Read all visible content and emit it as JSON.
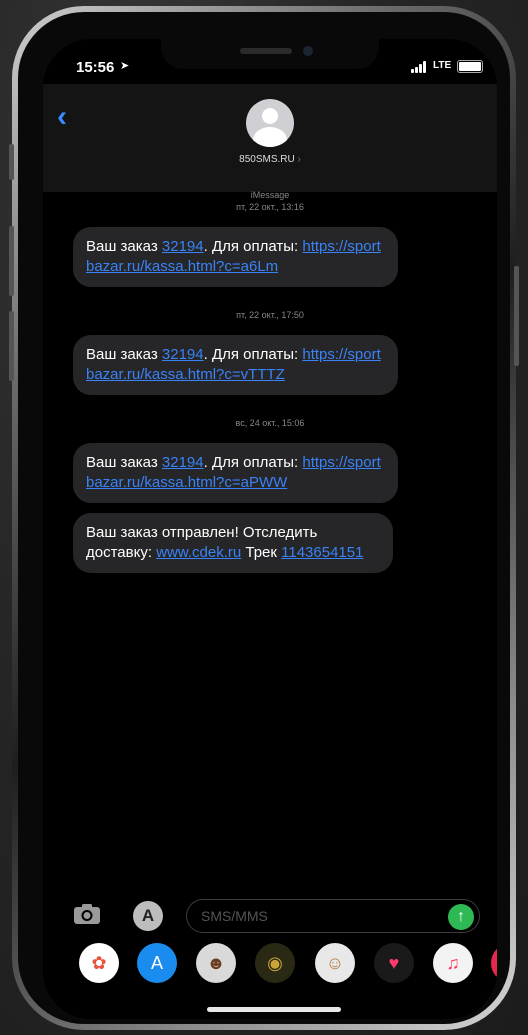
{
  "status_bar": {
    "time": "15:56",
    "network": "LTE"
  },
  "header": {
    "contact_name": "850SMS.RU"
  },
  "messages": [
    {
      "timestamp": "iMessage\nпт, 22 окт., 13:16",
      "text_before": "Ваш заказ ",
      "order": "32194",
      "text_mid": ". Для оплаты: ",
      "link": "https://sportbazar.ru/kassa.html?c=a6Lm"
    },
    {
      "timestamp": "пт, 22 окт., 17:50",
      "text_before": "Ваш заказ ",
      "order": "32194",
      "text_mid": ". Для оплаты: ",
      "link": "https://sportbazar.ru/kassa.html?c=vTTTZ"
    },
    {
      "timestamp": "вс, 24 окт., 15:06",
      "text_before": "Ваш заказ ",
      "order": "32194",
      "text_mid": ". Для оплаты: ",
      "link": "https://sportbazar.ru/kassa.html?c=aPWW"
    },
    {
      "text_before": "Ваш заказ отправлен! Отследить доставку: ",
      "link": "www.cdek.ru",
      "text_mid": " Трек ",
      "track": "1143654151"
    }
  ],
  "input": {
    "placeholder": "SMS/MMS"
  },
  "colors": {
    "link": "#3a82f7",
    "bubble": "#262628",
    "send": "#2fb955"
  },
  "app_strip": [
    {
      "name": "photos-app-icon",
      "glyph": "✿",
      "bg": "#ffffff",
      "fg": "#e8543c"
    },
    {
      "name": "app-store-icon",
      "glyph": "A",
      "bg": "#1a8cf0",
      "fg": "#ffffff"
    },
    {
      "name": "memoji-icon",
      "glyph": "☻",
      "bg": "#d9d9d9",
      "fg": "#6b3d1f"
    },
    {
      "name": "music-disc-icon",
      "glyph": "◉",
      "bg": "#2a2a14",
      "fg": "#c9a53a"
    },
    {
      "name": "animoji-icon",
      "glyph": "☺",
      "bg": "#e8e8e8",
      "fg": "#b07a3c"
    },
    {
      "name": "digital-touch-icon",
      "glyph": "♥",
      "bg": "#1a1a1a",
      "fg": "#ff3b6b"
    },
    {
      "name": "itunes-music-icon",
      "glyph": "♫",
      "bg": "#f3f3f3",
      "fg": "#fc3c5e"
    },
    {
      "name": "more-apps-icon",
      "glyph": "●",
      "bg": "#e3294d",
      "fg": "#ffffff"
    }
  ]
}
